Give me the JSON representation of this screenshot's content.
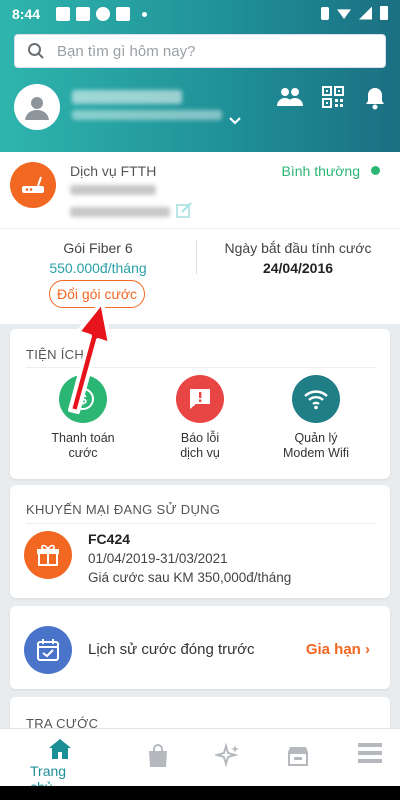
{
  "status_bar": {
    "time": "8:44"
  },
  "search": {
    "placeholder": "Bạn tìm gì hôm nay?"
  },
  "header_icons": [
    "group-icon",
    "qr-code-icon",
    "bell-icon"
  ],
  "service": {
    "name": "Dịch vụ FTTH",
    "status": "Bình thường",
    "package_name": "Gói Fiber 6",
    "package_price": "550.000đ/tháng",
    "start_label": "Ngày bắt đầu tính cước",
    "start_date": "24/04/2016",
    "change_button": "Đổi gói cước"
  },
  "utilities": {
    "title": "TIỆN ÍCH",
    "items": [
      {
        "label_line1": "Thanh toán",
        "label_line2": "cước",
        "icon": "dollar-icon",
        "color": "#2bb673"
      },
      {
        "label_line1": "Báo lỗi",
        "label_line2": "dịch vụ",
        "icon": "alert-icon",
        "color": "#e84545"
      },
      {
        "label_line1": "Quản lý",
        "label_line2": "Modem Wifi",
        "icon": "wifi-icon",
        "color": "#1f7e86"
      }
    ]
  },
  "promotion": {
    "title": "KHUYẾN MẠI ĐANG SỬ DỤNG",
    "code": "FC424",
    "dates": "01/04/2019-31/03/2021",
    "price_text": "Giá cước sau KM 350,000đ/tháng"
  },
  "history": {
    "label": "Lịch sử cước đóng trước",
    "action": "Gia hạn"
  },
  "lookup": {
    "title": "TRA CƯỚC"
  },
  "bottom_nav": {
    "home_label": "Trang chủ"
  },
  "colors": {
    "teal": "#1c8e96",
    "orange": "#f26722",
    "green": "#2bb673",
    "red": "#e84545"
  }
}
